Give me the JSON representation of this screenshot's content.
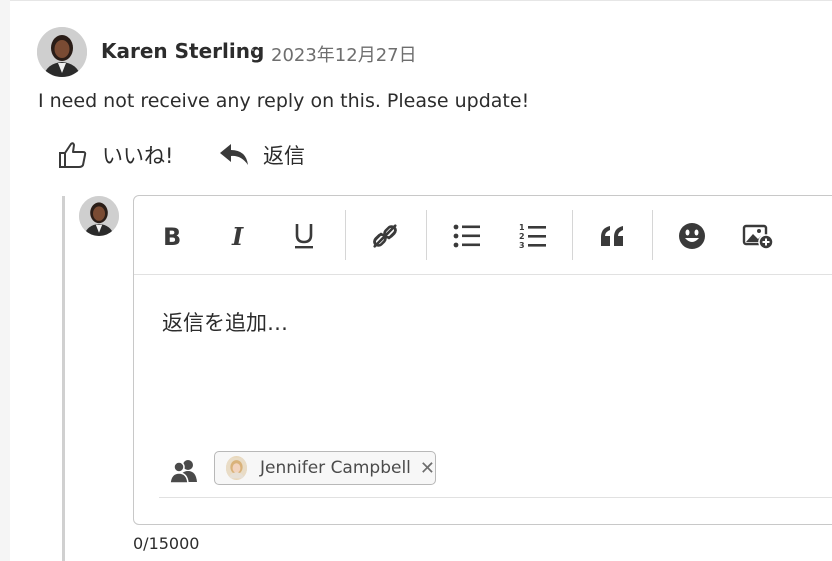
{
  "comment": {
    "author": "Karen Sterling",
    "separator": "·",
    "date": "2023年12月27日",
    "body": "I need not receive any reply on this. Please update!"
  },
  "actions": {
    "like_label": "いいね!",
    "reply_label": "返信"
  },
  "editor": {
    "toolbar": [
      {
        "name": "bold",
        "icon": "bold-icon"
      },
      {
        "name": "italic",
        "icon": "italic-icon"
      },
      {
        "name": "underline",
        "icon": "underline-icon"
      },
      {
        "name": "link",
        "icon": "link-icon"
      },
      {
        "name": "bulleted-list",
        "icon": "bullet-list-icon"
      },
      {
        "name": "numbered-list",
        "icon": "numbered-list-icon"
      },
      {
        "name": "quote",
        "icon": "quote-icon"
      },
      {
        "name": "emoji",
        "icon": "emoji-icon"
      },
      {
        "name": "insert-image",
        "icon": "image-add-icon"
      }
    ],
    "placeholder": "返信を追加…",
    "mention_chip": {
      "name": "Jennifer Campbell",
      "remove_symbol": "✕"
    },
    "counter": "0/15000"
  },
  "colors": {
    "text": "#2c2c2c",
    "muted": "#6e6e6e",
    "border": "#c8c8c8"
  }
}
